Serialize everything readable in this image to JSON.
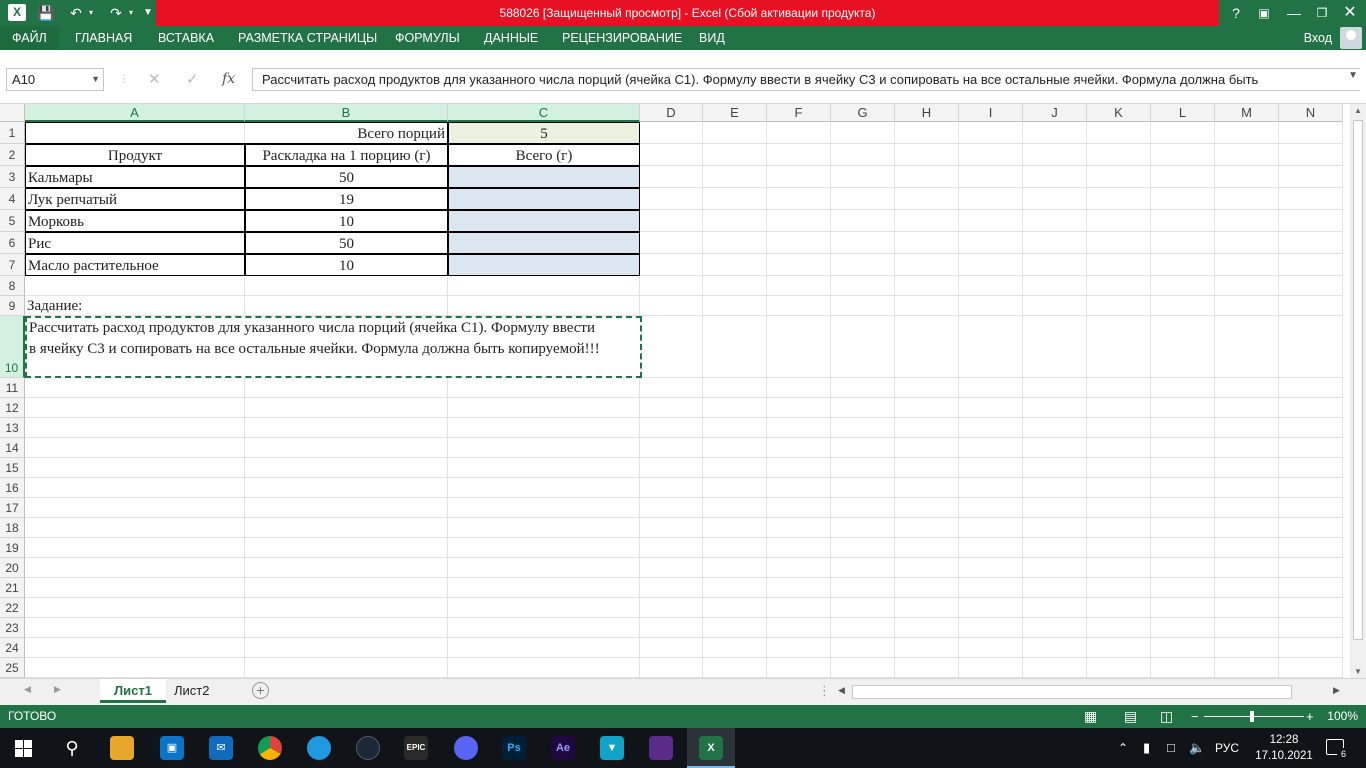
{
  "window": {
    "title": "588026  [Защищенный просмотр]  -  Excel (Сбой активации продукта)",
    "app_icon": "X",
    "colors": {
      "excel_green": "#217346",
      "title_red": "#e81123",
      "input_cell": "#dce6f1",
      "total_cell": "#ebf1de"
    }
  },
  "ribbon": {
    "tabs": [
      "ФАЙЛ",
      "ГЛАВНАЯ",
      "ВСТАВКА",
      "РАЗМЕТКА СТРАНИЦЫ",
      "ФОРМУЛЫ",
      "ДАННЫЕ",
      "РЕЦЕНЗИРОВАНИЕ",
      "ВИД"
    ],
    "login": "Вход"
  },
  "formula_bar": {
    "name_box": "A10",
    "fx": "fx",
    "content": "Рассчитать расход продуктов для указанного числа порций (ячейка С1). Формулу ввести в ячейку С3 и сопировать на все остальные ячейки. Формула должна быть"
  },
  "grid": {
    "columns": [
      "A",
      "B",
      "C",
      "D",
      "E",
      "F",
      "G",
      "H",
      "I",
      "J",
      "K",
      "L",
      "M",
      "N"
    ],
    "rows": [
      "1",
      "2",
      "3",
      "4",
      "5",
      "6",
      "7",
      "8",
      "9",
      "10",
      "11",
      "12",
      "13",
      "14",
      "15",
      "16",
      "17",
      "18",
      "19",
      "20",
      "21",
      "22",
      "23",
      "24",
      "25"
    ],
    "cells": {
      "B1": "Всего порций",
      "C1": "5",
      "A2": "Продукт",
      "B2": "Раскладка на 1 порцию (г)",
      "C2": "Всего (г)",
      "A3": "Кальмары",
      "B3": "50",
      "A4": "Лук репчатый",
      "B4": "19",
      "A5": "Морковь",
      "B5": "10",
      "A6": "Рис",
      "B6": "50",
      "A7": "Масло растительное",
      "B7": "10",
      "A9": "Задание:",
      "A10_line1": "Рассчитать расход продуктов для указанного числа порций (ячейка С1). Формулу ввести",
      "A10_line2": "в ячейку С3 и сопировать на все остальные ячейки. Формула должна быть копируемой!!!"
    }
  },
  "sheets": {
    "tabs": [
      "Лист1",
      "Лист2"
    ],
    "active": "Лист1",
    "add": "+"
  },
  "status": {
    "text": "ГОТОВО",
    "zoom": "100%",
    "zoom_minus": "−",
    "zoom_plus": "+"
  },
  "taskbar": {
    "language": "РУС",
    "time": "12:28",
    "date": "17.10.2021",
    "notifications": "6"
  }
}
